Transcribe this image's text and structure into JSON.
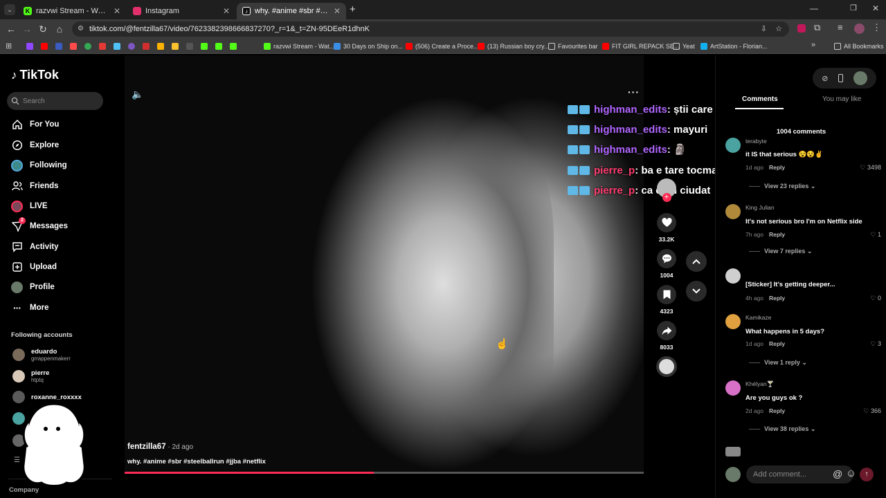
{
  "browser": {
    "tabs": [
      {
        "title": "razvwi Stream - Watch Live on K",
        "icon": "kick-icon",
        "color": "#53fc18",
        "active": false
      },
      {
        "title": "Instagram",
        "icon": "instagram-icon",
        "color": "#e1306c",
        "active": false
      },
      {
        "title": "why. #anime #sbr #steelball",
        "icon": "tiktok-icon",
        "color": "#000000",
        "active": true
      }
    ],
    "url": "tiktok.com/@fentzilla67/video/76233823986668372​70?_r=1&_t=ZN-95DEeR1dhnK",
    "bookmarks": [
      {
        "label": "razvwi Stream - Wat...",
        "color": "#53fc18"
      },
      {
        "label": "30 Days on Ship on...",
        "color": "#3a8ee6"
      },
      {
        "label": "(506) Create a Proce...",
        "color": "#ff0000"
      },
      {
        "label": "(13) Russian boy cry...",
        "color": "#ff0000"
      },
      {
        "label": "Favourites bar",
        "color": "#cccccc"
      },
      {
        "label": "FIT GIRL REPACK SE...",
        "color": "#ff0000"
      },
      {
        "label": "Yeat",
        "color": "#cccccc"
      },
      {
        "label": "ArtStation - Florian...",
        "color": "#13aff0"
      }
    ],
    "all_bookmarks": "All Bookmarks"
  },
  "sidebar": {
    "logo": "TikTok",
    "search_placeholder": "Search",
    "items": [
      {
        "label": "For You",
        "icon": "home-icon"
      },
      {
        "label": "Explore",
        "icon": "compass-icon"
      },
      {
        "label": "Following",
        "icon": "following-avatar-icon"
      },
      {
        "label": "Friends",
        "icon": "friends-icon"
      },
      {
        "label": "LIVE",
        "icon": "live-avatar-icon"
      },
      {
        "label": "Messages",
        "icon": "messages-icon",
        "badge": "2"
      },
      {
        "label": "Activity",
        "icon": "activity-icon"
      },
      {
        "label": "Upload",
        "icon": "upload-icon"
      },
      {
        "label": "Profile",
        "icon": "profile-avatar-icon"
      },
      {
        "label": "More",
        "icon": "more-icon"
      }
    ],
    "following_title": "Following accounts",
    "accounts": [
      {
        "name": "eduardo",
        "handle": "grrappenmakerr"
      },
      {
        "name": "pierre",
        "handle": "htptq"
      },
      {
        "name": "roxanne_roxxxx",
        "handle": ""
      }
    ],
    "company": "Company"
  },
  "video": {
    "author": "fentzilla67",
    "age": " · 2d ago",
    "caption": "why. #anime #sbr #steelballrun #jjba #netflix",
    "progress": 0.48
  },
  "chat": [
    {
      "user": "highman_edits",
      "msg": " : știi care e preferatul lui kubo?",
      "color": "purple"
    },
    {
      "user": "highman_edits",
      "msg": " : mayuri",
      "color": "purple"
    },
    {
      "user": "highman_edits",
      "msg": " :  🗿",
      "color": "purple"
    },
    {
      "user": "pierre_p",
      "msg": " : ba e tare tocmai de aia",
      "color": "red"
    },
    {
      "user": "pierre_p",
      "msg": " : ca e un ciudat",
      "color": "red"
    }
  ],
  "actions": {
    "likes": "33.2K",
    "comments": "1004",
    "saves": "4323",
    "shares": "8033"
  },
  "panel": {
    "tab_comments": "Comments",
    "tab_may_like": "You may like",
    "count": "1004 comments",
    "comments": [
      {
        "user": "terabyte",
        "text": "it IS that serious 😵😵✌️",
        "time": "1d ago",
        "reply": "Reply",
        "likes": "3498",
        "replies": "View 23 replies",
        "color": "#4aa3a0"
      },
      {
        "user": "King Julian",
        "text": "It's not serious bro I'm on Netflix side",
        "time": "7h ago",
        "reply": "Reply",
        "likes": "1",
        "replies": "View 7 replies",
        "color": "#b08a3a"
      },
      {
        "user": "",
        "text": "[Sticker] It's getting deeper...",
        "time": "4h ago",
        "reply": "Reply",
        "likes": "0",
        "replies": "",
        "color": "#cfcfcf"
      },
      {
        "user": "Kamikaze",
        "text": "What happens in 5 days?",
        "time": "1d ago",
        "reply": "Reply",
        "likes": "3",
        "replies": "View 1 reply",
        "color": "#e0a040"
      },
      {
        "user": "Khélyan🍸",
        "text": "Are you guys ok ?",
        "time": "2d ago",
        "reply": "Reply",
        "likes": "366",
        "replies": "View 38 replies",
        "color": "#d870c8"
      }
    ],
    "add_placeholder": "Add comment..."
  }
}
